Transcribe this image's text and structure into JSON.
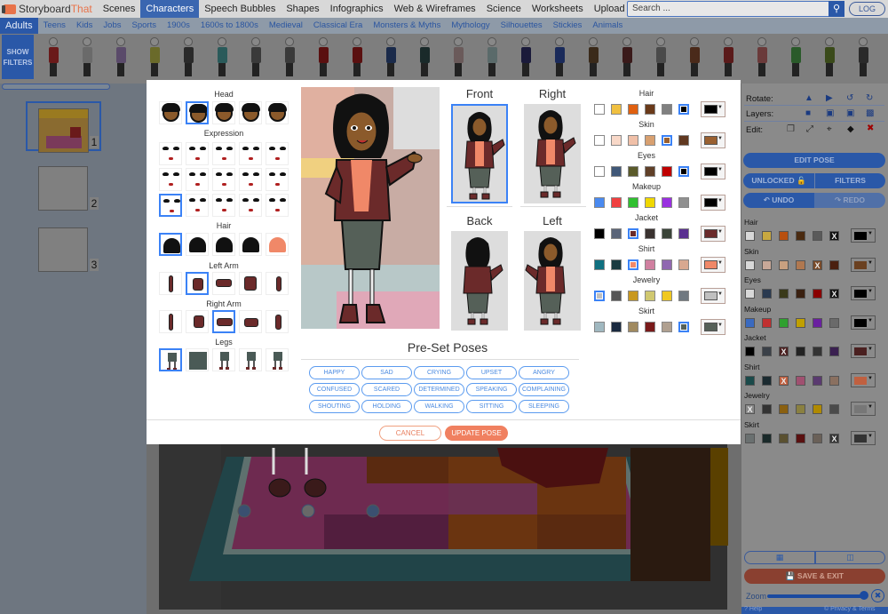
{
  "topbar": {
    "logo_part1": "Storyboard",
    "logo_part2": "That",
    "nav": [
      "Scenes",
      "Characters",
      "Speech Bubbles",
      "Shapes",
      "Infographics",
      "Web & Wireframes",
      "Science",
      "Worksheets",
      "Upload"
    ],
    "nav_active": "Characters",
    "search_placeholder": "Search ...",
    "search_icon": "magnifier",
    "logout_label": "LOG OUT"
  },
  "subnav": {
    "items": [
      "Adults",
      "Teens",
      "Kids",
      "Jobs",
      "Sports",
      "1900s",
      "1600s to 1800s",
      "Medieval",
      "Classical Era",
      "Monsters & Myths",
      "Mythology",
      "Silhouettes",
      "Stickies",
      "Animals"
    ],
    "active": "Adults"
  },
  "char_strip": {
    "show_filters": "SHOW FILTERS",
    "outfit_colors": [
      "#6a1a1a",
      "#6a6a6a",
      "#5a4a6a",
      "#6a6a2a",
      "#2a2a2a",
      "#2a5a5a",
      "#3a3a3a",
      "#3a3a3a",
      "#5a1010",
      "#5a1010",
      "#1a2a4a",
      "#1a2a2a",
      "#6a5a5a",
      "#5a6a6a",
      "#1a1a3a",
      "#1a2a5a",
      "#3a2a1a",
      "#3a1a1a",
      "#4a4a4a",
      "#4a2a1a",
      "#5a1a1a",
      "#6a3a3a",
      "#2a5a2a",
      "#3a4a1a",
      "#2a2a2a"
    ]
  },
  "cells": [
    {
      "num": "1"
    },
    {
      "num": "2"
    },
    {
      "num": "3"
    }
  ],
  "right_panel": {
    "rotate_label": "Rotate:",
    "layers_label": "Layers:",
    "edit_label": "Edit:",
    "edit_pose": "EDIT POSE",
    "unlocked": "UNLOCKED",
    "filters": "FILTERS",
    "undo": "UNDO",
    "redo": "REDO",
    "save_exit": "SAVE & EXIT",
    "zoom_label": "Zoom",
    "help": "Help",
    "privacy": "© Privacy & Terms",
    "groups": [
      {
        "label": "Hair",
        "swatches": [
          "#d8d8d8",
          "#c8a840",
          "#b85010",
          "#4a2a10",
          "#5a5a5a",
          "#111111"
        ],
        "selected": 5,
        "current": "#000000"
      },
      {
        "label": "Skin",
        "swatches": [
          "#d8d8d8",
          "#c8a898",
          "#c8a080",
          "#b07850",
          "#7a4a28",
          "#4a2010"
        ],
        "selected": 4,
        "current": "#6a4020"
      },
      {
        "label": "Eyes",
        "swatches": [
          "#d8d8d8",
          "#2a3a50",
          "#3a3a1a",
          "#3a2010",
          "#8a0000",
          "#111111"
        ],
        "selected": 5,
        "current": "#000000"
      },
      {
        "label": "Makeup",
        "swatches": [
          "#3a6ac0",
          "#c03030",
          "#30a030",
          "#c0a000",
          "#6a20a0",
          "#6a6a6a"
        ],
        "selected": -1,
        "current": "#000000"
      },
      {
        "label": "Jacket",
        "swatches": [
          "#000000",
          "#3a4048",
          "#4a2020",
          "#222222",
          "#333333",
          "#3a2050"
        ],
        "selected": 2,
        "current": "#4a2020"
      },
      {
        "label": "Shirt",
        "swatches": [
          "#1a4a4a",
          "#1a2a30",
          "#c06040",
          "#a05070",
          "#5a3a70",
          "#8a7060"
        ],
        "selected": 2,
        "current": "#c06040"
      },
      {
        "label": "Jewelry",
        "swatches": [
          "#888888",
          "#333333",
          "#8a6010",
          "#8a8040",
          "#b08a00",
          "#4a4a4a"
        ],
        "selected": 0,
        "current": "#777777"
      },
      {
        "label": "Skirt",
        "swatches": [
          "#6a7070",
          "#1a2a2a",
          "#5a5030",
          "#5a1010",
          "#6a6058",
          "#333333"
        ],
        "selected": 5,
        "current": "#333333"
      }
    ]
  },
  "modal": {
    "sections": {
      "head": "Head",
      "expression": "Expression",
      "hair": "Hair",
      "left_arm": "Left Arm",
      "right_arm": "Right Arm",
      "legs": "Legs"
    },
    "selected": {
      "head": 1,
      "expression": 10,
      "hair": 0,
      "left_arm": 1,
      "right_arm": 2,
      "legs": 0
    },
    "views": [
      "Front",
      "Right",
      "Back",
      "Left"
    ],
    "selected_view": "Front",
    "color_groups": [
      {
        "label": "Hair",
        "swatches": [
          "#ffffff",
          "#f0c040",
          "#e06010",
          "#6a3a1a",
          "#808080",
          "#000000"
        ],
        "selected": 5,
        "current": "#000000"
      },
      {
        "label": "Skin",
        "swatches": [
          "#ffffff",
          "#f8d8c8",
          "#f0c0a8",
          "#d8a070",
          "#9a6030",
          "#603820"
        ],
        "selected": 4,
        "current": "#9a6030"
      },
      {
        "label": "Eyes",
        "swatches": [
          "#ffffff",
          "#405878",
          "#5a5a2a",
          "#604028",
          "#c00000",
          "#000000"
        ],
        "selected": 5,
        "current": "#000000"
      },
      {
        "label": "Makeup",
        "swatches": [
          "#4a8af0",
          "#f04040",
          "#30c030",
          "#f0d800",
          "#9a30e0",
          "#909090"
        ],
        "selected": -1,
        "current": "#000000"
      },
      {
        "label": "Jacket",
        "swatches": [
          "#000000",
          "#5a6478",
          "#6a2a2a",
          "#3a3230",
          "#3a4438",
          "#5a3090"
        ],
        "selected": 2,
        "current": "#6a2a2a"
      },
      {
        "label": "Shirt",
        "swatches": [
          "#107080",
          "#1a3a40",
          "#f08868",
          "#d080a0",
          "#9068b0",
          "#d8a890"
        ],
        "selected": 2,
        "current": "#f08868"
      },
      {
        "label": "Jewelry",
        "swatches": [
          "#c0c0c0",
          "#555555",
          "#c89820",
          "#d0c870",
          "#f0c820",
          "#707880"
        ],
        "selected": 0,
        "current": "#c0c0c0"
      },
      {
        "label": "Skirt",
        "swatches": [
          "#a0b8c0",
          "#1a2a40",
          "#a08a60",
          "#7a1a1a",
          "#b0a090",
          "#556058"
        ],
        "selected": 5,
        "current": "#556058"
      }
    ],
    "preset_title": "Pre-Set Poses",
    "poses": [
      "HAPPY",
      "SAD",
      "CRYING",
      "UPSET",
      "ANGRY",
      "CONFUSED",
      "SCARED",
      "DETERMINED",
      "SPEAKING",
      "COMPLAINING",
      "SHOUTING",
      "HOLDING",
      "WALKING",
      "SITTING",
      "SLEEPING"
    ],
    "cancel": "CANCEL",
    "update_pose": "UPDATE POSE"
  }
}
